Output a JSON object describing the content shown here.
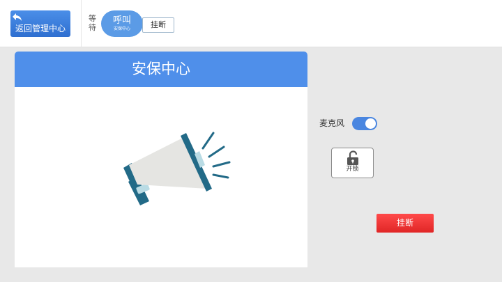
{
  "topbar": {
    "back_label": "返回管理中心",
    "wait_text": "等待",
    "call": {
      "label": "呼叫",
      "target": "安保中心"
    },
    "hangup_label": "挂断"
  },
  "main": {
    "title": "安保中心"
  },
  "controls": {
    "mic_label": "麦克风",
    "mic_on": true,
    "unlock_label": "开锁",
    "hangup_label": "挂断"
  },
  "colors": {
    "accent": "#4f8fea",
    "danger": "#e02626"
  }
}
